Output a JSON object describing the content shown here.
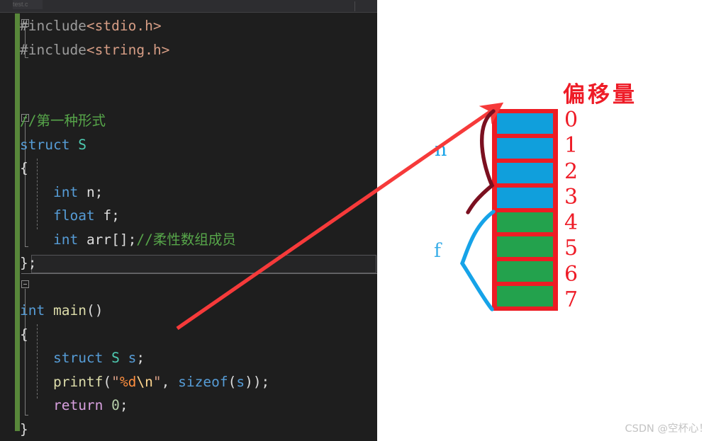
{
  "editor": {
    "tab_label": "test.c",
    "code_lines": [
      {
        "id": "l1",
        "fold": "open",
        "tokens": [
          {
            "t": "#include",
            "c": "c-pre"
          },
          {
            "t": "<stdio.h>",
            "c": "c-hdr"
          }
        ]
      },
      {
        "id": "l2",
        "fold": "none",
        "tokens": [
          {
            "t": "#include",
            "c": "c-pre"
          },
          {
            "t": "<string.h>",
            "c": "c-hdr"
          }
        ]
      },
      {
        "id": "l3",
        "fold": "none",
        "tokens": []
      },
      {
        "id": "l4",
        "fold": "none",
        "tokens": []
      },
      {
        "id": "l5",
        "fold": "none",
        "tokens": [
          {
            "t": "//第一种形式",
            "c": "c-cmt"
          }
        ]
      },
      {
        "id": "l6",
        "fold": "open",
        "tokens": [
          {
            "t": "struct",
            "c": "c-kw"
          },
          {
            "t": " ",
            "c": "c-plain"
          },
          {
            "t": "S",
            "c": "c-type"
          }
        ]
      },
      {
        "id": "l7",
        "fold": "none",
        "tokens": [
          {
            "t": "{",
            "c": "c-punc"
          }
        ]
      },
      {
        "id": "l8",
        "fold": "none",
        "tokens": [
          {
            "t": "    ",
            "c": "c-plain"
          },
          {
            "t": "int",
            "c": "c-kw"
          },
          {
            "t": " n;",
            "c": "c-plain"
          }
        ]
      },
      {
        "id": "l9",
        "fold": "none",
        "tokens": [
          {
            "t": "    ",
            "c": "c-plain"
          },
          {
            "t": "float",
            "c": "c-kw"
          },
          {
            "t": " f;",
            "c": "c-plain"
          }
        ]
      },
      {
        "id": "l10",
        "fold": "none",
        "tokens": [
          {
            "t": "    ",
            "c": "c-plain"
          },
          {
            "t": "int",
            "c": "c-kw"
          },
          {
            "t": " arr[];",
            "c": "c-plain"
          },
          {
            "t": "//柔性数组成员",
            "c": "c-cmt"
          }
        ]
      },
      {
        "id": "l11",
        "fold": "none",
        "tokens": [
          {
            "t": "};",
            "c": "c-punc"
          }
        ]
      },
      {
        "id": "l12",
        "fold": "none",
        "tokens": []
      },
      {
        "id": "l13",
        "fold": "open",
        "tokens": [
          {
            "t": "int",
            "c": "c-kw"
          },
          {
            "t": " ",
            "c": "c-plain"
          },
          {
            "t": "main",
            "c": "c-fn"
          },
          {
            "t": "()",
            "c": "c-punc"
          }
        ]
      },
      {
        "id": "l14",
        "fold": "none",
        "tokens": [
          {
            "t": "{",
            "c": "c-punc"
          }
        ]
      },
      {
        "id": "l15",
        "fold": "none",
        "tokens": [
          {
            "t": "    ",
            "c": "c-plain"
          },
          {
            "t": "struct",
            "c": "c-kw"
          },
          {
            "t": " ",
            "c": "c-plain"
          },
          {
            "t": "S",
            "c": "c-type"
          },
          {
            "t": " ",
            "c": "c-plain"
          },
          {
            "t": "s",
            "c": "c-call"
          },
          {
            "t": ";",
            "c": "c-punc"
          }
        ]
      },
      {
        "id": "l16",
        "fold": "none",
        "tokens": [
          {
            "t": "    ",
            "c": "c-plain"
          },
          {
            "t": "printf",
            "c": "c-fn"
          },
          {
            "t": "(",
            "c": "c-punc"
          },
          {
            "t": "\"",
            "c": "c-str"
          },
          {
            "t": "%d",
            "c": "c-fmt"
          },
          {
            "t": "\\n",
            "c": "c-esc"
          },
          {
            "t": "\"",
            "c": "c-str"
          },
          {
            "t": ", ",
            "c": "c-punc"
          },
          {
            "t": "sizeof",
            "c": "c-call"
          },
          {
            "t": "(",
            "c": "c-punc"
          },
          {
            "t": "s",
            "c": "c-call"
          },
          {
            "t": "));",
            "c": "c-punc"
          }
        ]
      },
      {
        "id": "l17",
        "fold": "none",
        "tokens": [
          {
            "t": "    ",
            "c": "c-plain"
          },
          {
            "t": "return",
            "c": "c-ret"
          },
          {
            "t": " ",
            "c": "c-plain"
          },
          {
            "t": "0",
            "c": "c-num"
          },
          {
            "t": ";",
            "c": "c-punc"
          }
        ]
      },
      {
        "id": "l18",
        "fold": "none",
        "tokens": [
          {
            "t": "}",
            "c": "c-punc"
          }
        ]
      }
    ]
  },
  "diagram": {
    "offset_title": "偏移量",
    "offsets": [
      "0",
      "1",
      "2",
      "3",
      "4",
      "5",
      "6",
      "7"
    ],
    "cells": [
      {
        "index": 0,
        "color": "blue",
        "hex": "#109FDC"
      },
      {
        "index": 1,
        "color": "blue",
        "hex": "#109FDC"
      },
      {
        "index": 2,
        "color": "blue",
        "hex": "#109FDC"
      },
      {
        "index": 3,
        "color": "blue",
        "hex": "#109FDC"
      },
      {
        "index": 4,
        "color": "green",
        "hex": "#23A24D"
      },
      {
        "index": 5,
        "color": "green",
        "hex": "#23A24D"
      },
      {
        "index": 6,
        "color": "green",
        "hex": "#23A24D"
      },
      {
        "index": 7,
        "color": "green",
        "hex": "#23A24D"
      }
    ],
    "brace_n_label": "n",
    "brace_f_label": "f",
    "border_color": "#ED1C24",
    "offset_text_color": "#EE1C27",
    "brace_n_color": "#7B1020",
    "brace_f_color": "#16A3E8",
    "arrow_color": "#F63A3A"
  },
  "watermark": "CSDN @空杯心！"
}
